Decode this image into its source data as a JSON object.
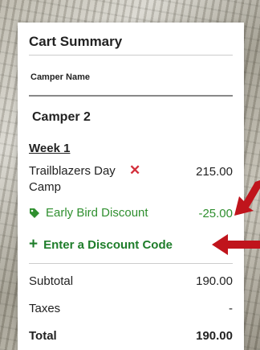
{
  "cart": {
    "title": "Cart Summary",
    "column_header": "Camper Name",
    "camper": "Camper 2",
    "week": "Week 1",
    "item": {
      "name": "Trailblazers Day Camp",
      "price": "215.00",
      "remove_glyph": "✕"
    },
    "discount": {
      "label": "Early Bird Discount",
      "amount": "-25.00"
    },
    "enter_code": {
      "plus": "+",
      "label": "Enter a Discount Code"
    },
    "subtotal": {
      "label": "Subtotal",
      "value": "190.00"
    },
    "taxes": {
      "label": "Taxes",
      "value": "-"
    },
    "total": {
      "label": "Total",
      "value": "190.00"
    }
  },
  "colors": {
    "discount_green": "#2f8f2f",
    "link_green": "#1e7d2a",
    "remove_red": "#d32f3b",
    "arrow_red": "#c0141c"
  },
  "icons": [
    "tag-icon",
    "remove-icon",
    "plus-icon",
    "arrow-icon"
  ]
}
